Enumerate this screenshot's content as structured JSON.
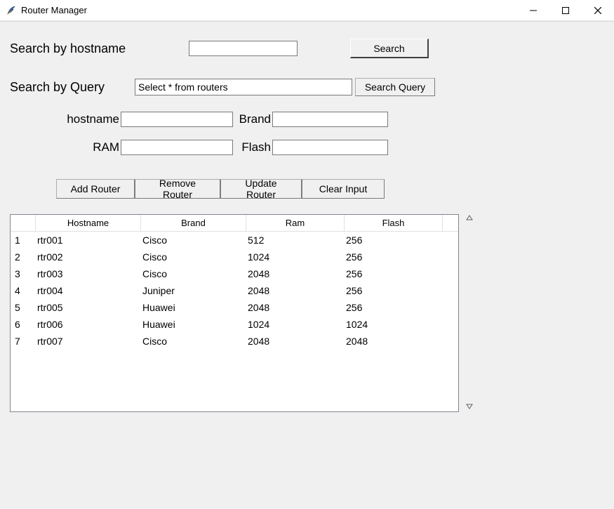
{
  "window": {
    "title": "Router Manager"
  },
  "search_hostname": {
    "label": "Search by hostname",
    "value": "",
    "button": "Search"
  },
  "search_query": {
    "label": "Search by Query",
    "value": "Select * from routers",
    "button": "Search Query"
  },
  "fields": {
    "hostname": {
      "label": "hostname",
      "value": ""
    },
    "brand": {
      "label": "Brand",
      "value": ""
    },
    "ram": {
      "label": "RAM",
      "value": ""
    },
    "flash": {
      "label": "Flash",
      "value": ""
    }
  },
  "actions": {
    "add": "Add Router",
    "remove": "Remove Router",
    "update": "Update Router",
    "clear": "Clear Input"
  },
  "table": {
    "columns": [
      "Hostname",
      "Brand",
      "Ram",
      "Flash"
    ],
    "rows": [
      {
        "id": "1",
        "hostname": "rtr001",
        "brand": "Cisco",
        "ram": "512",
        "flash": "256"
      },
      {
        "id": "2",
        "hostname": "rtr002",
        "brand": "Cisco",
        "ram": "1024",
        "flash": "256"
      },
      {
        "id": "3",
        "hostname": "rtr003",
        "brand": "Cisco",
        "ram": "2048",
        "flash": "256"
      },
      {
        "id": "4",
        "hostname": "rtr004",
        "brand": "Juniper",
        "ram": "2048",
        "flash": "256"
      },
      {
        "id": "5",
        "hostname": "rtr005",
        "brand": "Huawei",
        "ram": "2048",
        "flash": "256"
      },
      {
        "id": "6",
        "hostname": "rtr006",
        "brand": "Huawei",
        "ram": "1024",
        "flash": "1024"
      },
      {
        "id": "7",
        "hostname": "rtr007",
        "brand": "Cisco",
        "ram": "2048",
        "flash": "2048"
      }
    ]
  }
}
